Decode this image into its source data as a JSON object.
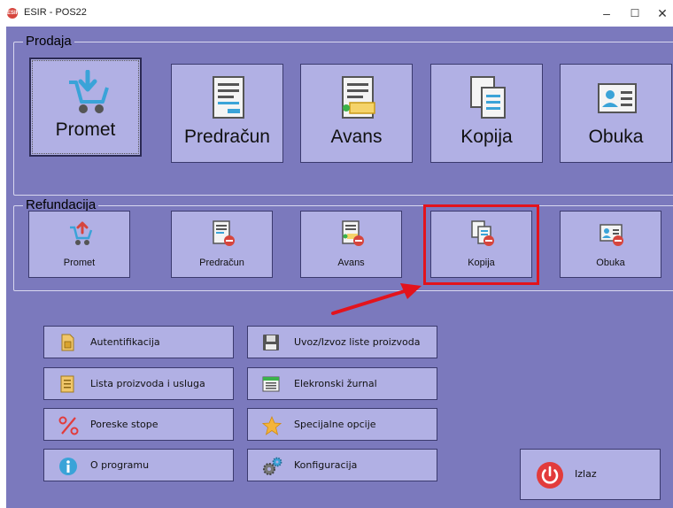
{
  "window": {
    "title": "ESIR - POS22",
    "icon_text": "ESIR",
    "minimize_glyph": "–",
    "maximize_glyph": "☐",
    "close_glyph": "✕"
  },
  "prodaja": {
    "label": "Prodaja",
    "buttons": [
      {
        "label": "Promet",
        "icon": "shopping-cart-icon"
      },
      {
        "label": "Predračun",
        "icon": "document-icon"
      },
      {
        "label": "Avans",
        "icon": "advance-document-icon"
      },
      {
        "label": "Kopija",
        "icon": "copy-icon"
      },
      {
        "label": "Obuka",
        "icon": "id-card-icon"
      }
    ]
  },
  "refundacija": {
    "label": "Refundacija",
    "buttons": [
      {
        "label": "Promet",
        "icon": "shopping-cart-refund-icon"
      },
      {
        "label": "Predračun",
        "icon": "document-refund-icon"
      },
      {
        "label": "Avans",
        "icon": "advance-refund-icon"
      },
      {
        "label": "Kopija",
        "icon": "copy-refund-icon"
      },
      {
        "label": "Obuka",
        "icon": "id-card-refund-icon"
      }
    ]
  },
  "menu": {
    "left": [
      {
        "label": "Autentifikacija",
        "icon": "sim-card-icon"
      },
      {
        "label": "Lista proizvoda i usluga",
        "icon": "list-icon"
      },
      {
        "label": "Poreske stope",
        "icon": "percent-icon"
      },
      {
        "label": "O programu",
        "icon": "info-icon"
      }
    ],
    "right": [
      {
        "label": "Uvoz/Izvoz liste proizvoda",
        "icon": "floppy-disk-icon"
      },
      {
        "label": "Elekronski žurnal",
        "icon": "journal-icon"
      },
      {
        "label": "Specijalne opcije",
        "icon": "star-icon"
      },
      {
        "label": "Konfiguracija",
        "icon": "gears-icon"
      }
    ]
  },
  "exit": {
    "label": "Izlaz",
    "icon": "power-icon"
  },
  "colors": {
    "background": "#7b79bd",
    "button": "#b1b0e4",
    "highlight": "#e3131c",
    "accent_blue": "#3aa3d8"
  }
}
